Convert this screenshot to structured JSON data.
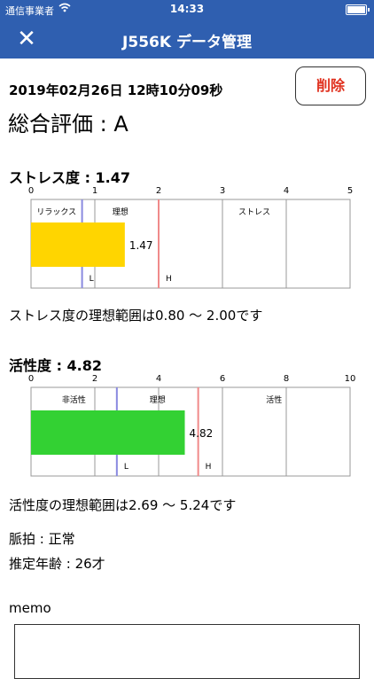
{
  "status_bar": {
    "carrier": "通信事業者",
    "time": "14:33"
  },
  "nav": {
    "title": "J556K データ管理"
  },
  "record": {
    "datetime": "2019年02月26日 12時10分09秒",
    "overall": "総合評価 : A",
    "delete_label": "削除"
  },
  "colors": {
    "bar_stress": "#ffd500",
    "bar_activity": "#33d133",
    "nav": "#2f5fb0",
    "delete": "#e0301e",
    "low_line": "#8a8ae0",
    "high_line": "#f08a8a"
  },
  "stress": {
    "title": "ストレス度 : 1.47",
    "range_text": "ストレス度の理想範囲は0.80 〜 2.00です",
    "zone_labels": [
      "リラックス",
      "理想",
      "ストレス"
    ],
    "low_label": "L",
    "high_label": "H",
    "value_label": "1.47"
  },
  "activity": {
    "title": "活性度 : 4.82",
    "range_text": "活性度の理想範囲は2.69 〜 5.24です",
    "zone_labels": [
      "非活性",
      "理想",
      "活性"
    ],
    "low_label": "L",
    "high_label": "H",
    "value_label": "4.82"
  },
  "pulse": "脈拍 : 正常",
  "age": "推定年齢 : 26才",
  "memo_label": "memo",
  "chart_data": [
    {
      "type": "bar",
      "title": "ストレス度 : 1.47",
      "orientation": "horizontal",
      "xlim": [
        0,
        5
      ],
      "ticks": [
        "0",
        "1",
        "2",
        "3",
        "4",
        "5"
      ],
      "values": [
        1.47
      ],
      "ideal_range": [
        0.8,
        2.0
      ],
      "grid": true
    },
    {
      "type": "bar",
      "title": "活性度 : 4.82",
      "orientation": "horizontal",
      "xlim": [
        0,
        10
      ],
      "ticks": [
        "0",
        "2",
        "4",
        "6",
        "8",
        "10"
      ],
      "values": [
        4.82
      ],
      "ideal_range": [
        2.69,
        5.24
      ],
      "grid": true
    }
  ]
}
